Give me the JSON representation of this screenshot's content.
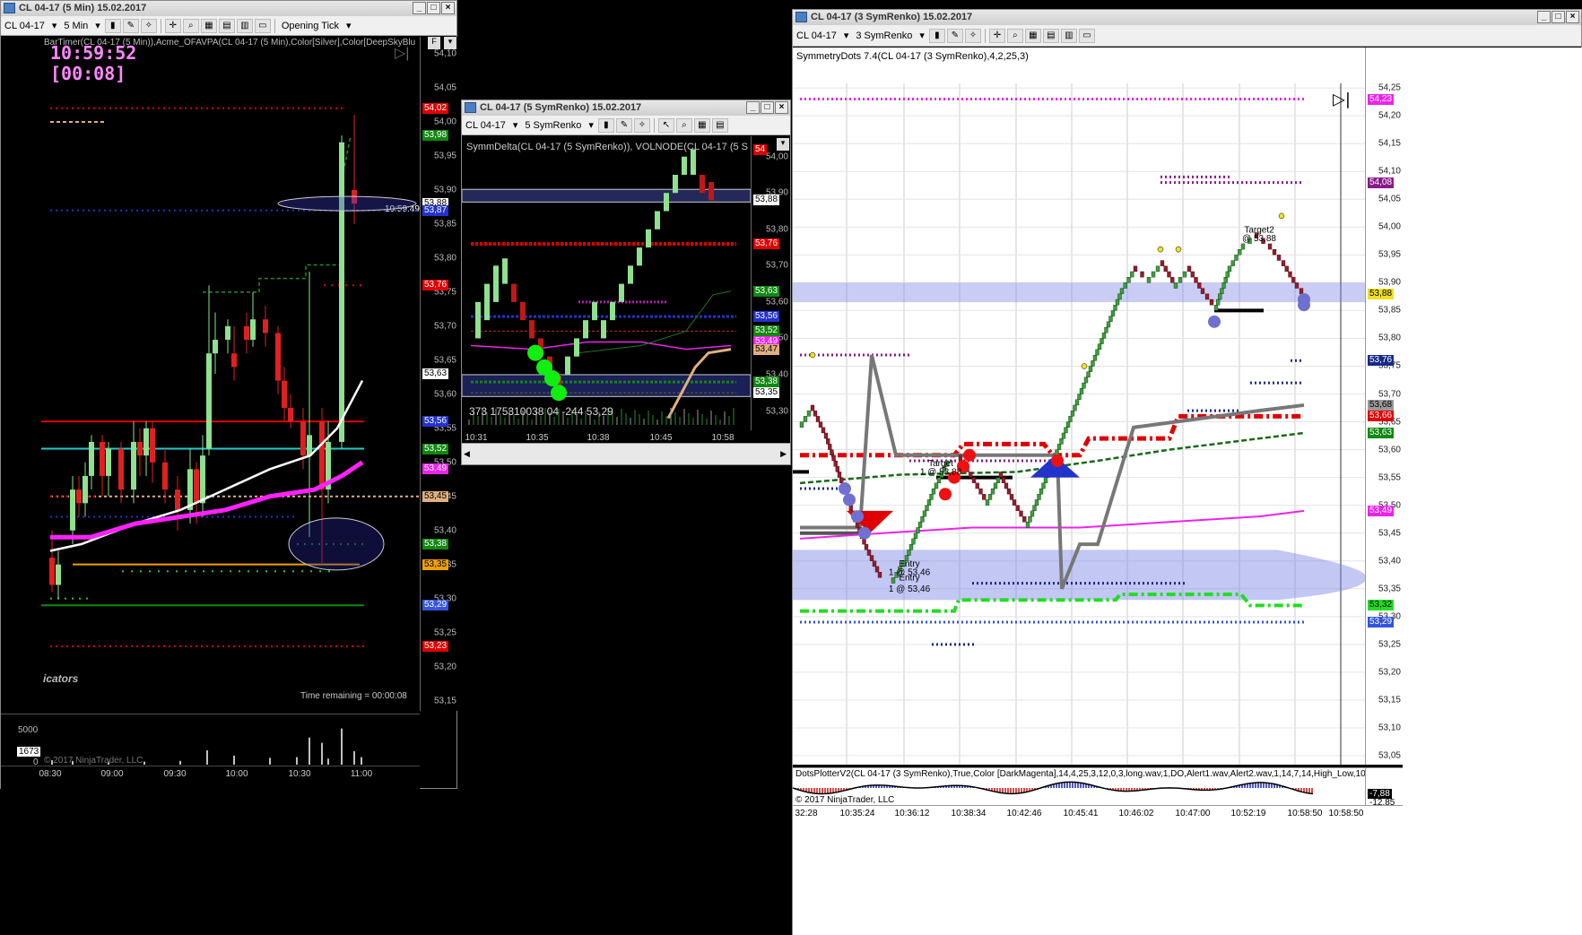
{
  "w1": {
    "title": "CL 04-17 (5 Min)  15.02.2017",
    "instrument": "CL 04-17",
    "interval": "5 Min",
    "tick_mode": "Opening Tick",
    "indicator_line": "BarTimer(CL 04-17 (5 Min)),Acme_OFAVPA(CL 04-17 (5 Min),Color[Silver],Color[DeepSkyBlu",
    "clock": "10:59:52",
    "countdown": "[00:08]",
    "time_remaining": "Time remaining = 00:00:08",
    "last_time": "10:59:49",
    "indicators_text": "icators",
    "copyright": "© 2017 NinjaTrader, LLC",
    "volume_ticks": [
      "5000",
      "0"
    ],
    "volume_label": "1673",
    "y_ticks": [
      "54,10",
      "54,05",
      "54,00",
      "53,95",
      "53,90",
      "53,85",
      "53,80",
      "53,75",
      "53,70",
      "53,65",
      "53,60",
      "53,55",
      "53,50",
      "53,45",
      "53,40",
      "53,35",
      "53,30",
      "53,25",
      "53,20",
      "53,15"
    ],
    "x_ticks": [
      "08:30",
      "09:00",
      "09:30",
      "10:00",
      "10:30",
      "11:00"
    ],
    "price_labels": [
      {
        "v": "54,02",
        "c": "#e00000"
      },
      {
        "v": "53,98",
        "c": "#118811"
      },
      {
        "v": "53,88",
        "c": "#ffffff",
        "t": "#000"
      },
      {
        "v": "53,87",
        "c": "#2233cc"
      },
      {
        "v": "53,76",
        "c": "#e00000"
      },
      {
        "v": "53,63",
        "c": "#ffffff",
        "t": "#000"
      },
      {
        "v": "53,56",
        "c": "#2233cc"
      },
      {
        "v": "53,52",
        "c": "#118811"
      },
      {
        "v": "53,49",
        "c": "#ee22ee"
      },
      {
        "v": "53,45",
        "c": "#e0b080",
        "t": "#000"
      },
      {
        "v": "53,38",
        "c": "#118811"
      },
      {
        "v": "53,35",
        "c": "#f0a000",
        "t": "#000"
      },
      {
        "v": "53,29",
        "c": "#3355dd"
      },
      {
        "v": "53,23",
        "c": "#e00000"
      }
    ]
  },
  "w2": {
    "title": "CL 04-17 (5 SymRenko)  15.02.2017",
    "instrument": "CL 04-17",
    "interval": "5 SymRenko",
    "indicator_line": "SymmDelta(CL 04-17 (5 SymRenko)), VOLNODE(CL 04-17 (5 S",
    "delta_text": "373  175310038 04  -244  53,29",
    "y_ticks": [
      "54,00",
      "53,90",
      "53,80",
      "53,70",
      "53,60",
      "53,50",
      "53,40",
      "53,30"
    ],
    "x_ticks": [
      "10:31",
      "10:35",
      "10:38",
      "10:45",
      "10:58"
    ],
    "price_labels": [
      {
        "v": "54",
        "c": "#e00000"
      },
      {
        "v": "53,88",
        "c": "#ffffff",
        "t": "#000"
      },
      {
        "v": "53,76",
        "c": "#e00000"
      },
      {
        "v": "53,63",
        "c": "#118811"
      },
      {
        "v": "53,56",
        "c": "#2233cc"
      },
      {
        "v": "53,52",
        "c": "#118811"
      },
      {
        "v": "53,49",
        "c": "#ee22ee"
      },
      {
        "v": "53,47",
        "c": "#e0b080",
        "t": "#000"
      },
      {
        "v": "53,38",
        "c": "#118811"
      },
      {
        "v": "53,35",
        "c": "#ffffff",
        "t": "#000"
      }
    ]
  },
  "w3": {
    "title": "CL 04-17 (3 SymRenko)  15.02.2017",
    "instrument": "CL 04-17",
    "interval": "3 SymRenko",
    "indicator_line": "SymmetryDots 7.4(CL 04-17 (3 SymRenko),4,2,25,3)",
    "osc_line": "DotsPlotterV2(CL 04-17 (3 SymRenko),True,Color [DarkMagenta],14,4,25,3,12,0,3,long.wav,1,DO,Alert1.wav,Alert2.wav,1,14,7,14,High_Low,10",
    "copyright": "© 2017 NinjaTrader, LLC",
    "osc_labels": [
      "-7,88",
      "-12,85"
    ],
    "y_ticks": [
      "54,25",
      "54,20",
      "54,15",
      "54,10",
      "54,05",
      "54,00",
      "53,95",
      "53,90",
      "53,85",
      "53,80",
      "53,75",
      "53,70",
      "53,65",
      "53,60",
      "53,55",
      "53,50",
      "53,45",
      "53,40",
      "53,35",
      "53,30",
      "53,25",
      "53,20",
      "53,15",
      "53,10",
      "53,05"
    ],
    "x_ticks": [
      "32:28",
      "10:35:24",
      "10:36:12",
      "10:38:34",
      "10:42:46",
      "10:45:41",
      "10:46:02",
      "10:47:00",
      "10:52:19",
      "10:58:50",
      "10:58:50"
    ],
    "price_labels": [
      {
        "v": "54,23",
        "c": "#ee22ee"
      },
      {
        "v": "54,08",
        "c": "#8a1a8a"
      },
      {
        "v": "53,88",
        "c": "#f0e020",
        "t": "#000"
      },
      {
        "v": "53,76",
        "c": "#1a2a88"
      },
      {
        "v": "53,68",
        "c": "#9a9a9a",
        "t": "#000"
      },
      {
        "v": "53,66",
        "c": "#e00000"
      },
      {
        "v": "53,63",
        "c": "#118811"
      },
      {
        "v": "53,49",
        "c": "#ee22ee"
      },
      {
        "v": "53,32",
        "c": "#22dd22",
        "t": "#000"
      },
      {
        "v": "53,29",
        "c": "#3355dd"
      }
    ],
    "annotations": [
      "Target2",
      "@ 53,88",
      "Target",
      "1 @ 53,88",
      "Entry",
      "1 @ 53,46",
      "Entry",
      "1 @ 53,46"
    ]
  }
}
